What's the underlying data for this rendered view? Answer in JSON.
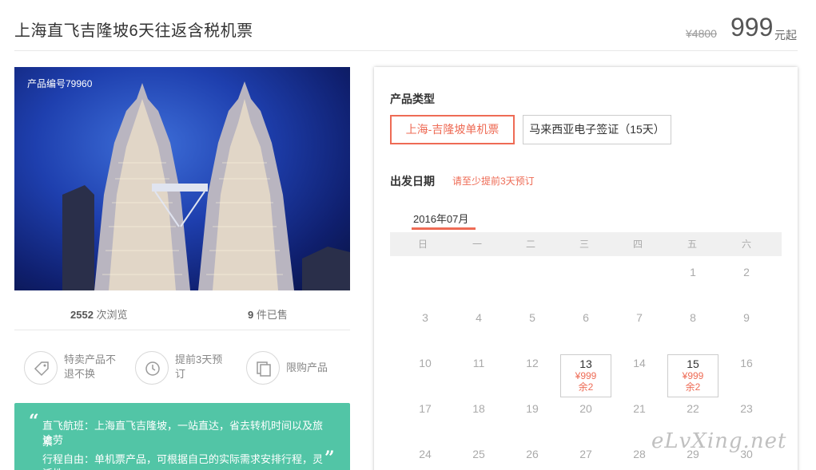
{
  "header": {
    "title": "上海直飞吉隆坡6天往返含税机票",
    "original_price": "¥4800",
    "price": "999",
    "price_suffix": "元起"
  },
  "product": {
    "number_label": "产品编号79960",
    "views_count": "2552",
    "views_label": " 次浏览",
    "sold_count": "9",
    "sold_label": " 件已售"
  },
  "features": [
    {
      "line1": "特卖产品不",
      "line2": "退不换",
      "icon": "tag-icon"
    },
    {
      "line1": "提前3天预",
      "line2": "订",
      "icon": "clock-icon"
    },
    {
      "line1": "限购产品",
      "line2": "",
      "icon": "copy-icon"
    }
  ],
  "description": {
    "open_quote": "“",
    "close_quote": "”",
    "line1": "直飞航班：上海直飞吉隆坡，一站直达，省去转机时间以及旅途劳",
    "line2": "累",
    "line3": "行程自由：单机票产品，可根据自己的实际需求安排行程，灵活性"
  },
  "booking": {
    "type_title": "产品类型",
    "options": [
      "上海-吉隆坡单机票",
      "马来西亚电子签证（15天）"
    ],
    "date_title": "出发日期",
    "date_hint": "请至少提前3天预订",
    "month": "2016年07月",
    "weekdays": [
      "日",
      "一",
      "二",
      "三",
      "四",
      "五",
      "六"
    ],
    "days": [
      "1",
      "2",
      "3",
      "4",
      "5",
      "6",
      "7",
      "8",
      "9",
      "10",
      "11",
      "12",
      "13",
      "14",
      "15",
      "16",
      "17",
      "18",
      "19",
      "20",
      "21",
      "22",
      "23",
      "24",
      "25",
      "26",
      "27",
      "28",
      "29",
      "30"
    ],
    "avail_13_price": "¥999",
    "avail_13_left": "余2",
    "avail_15_price": "¥999",
    "avail_15_left": "余2"
  },
  "watermark": "eLvXing.net",
  "colors": {
    "accent": "#ee6b55",
    "green": "#52c5a6",
    "sky": "#1e3fae"
  }
}
